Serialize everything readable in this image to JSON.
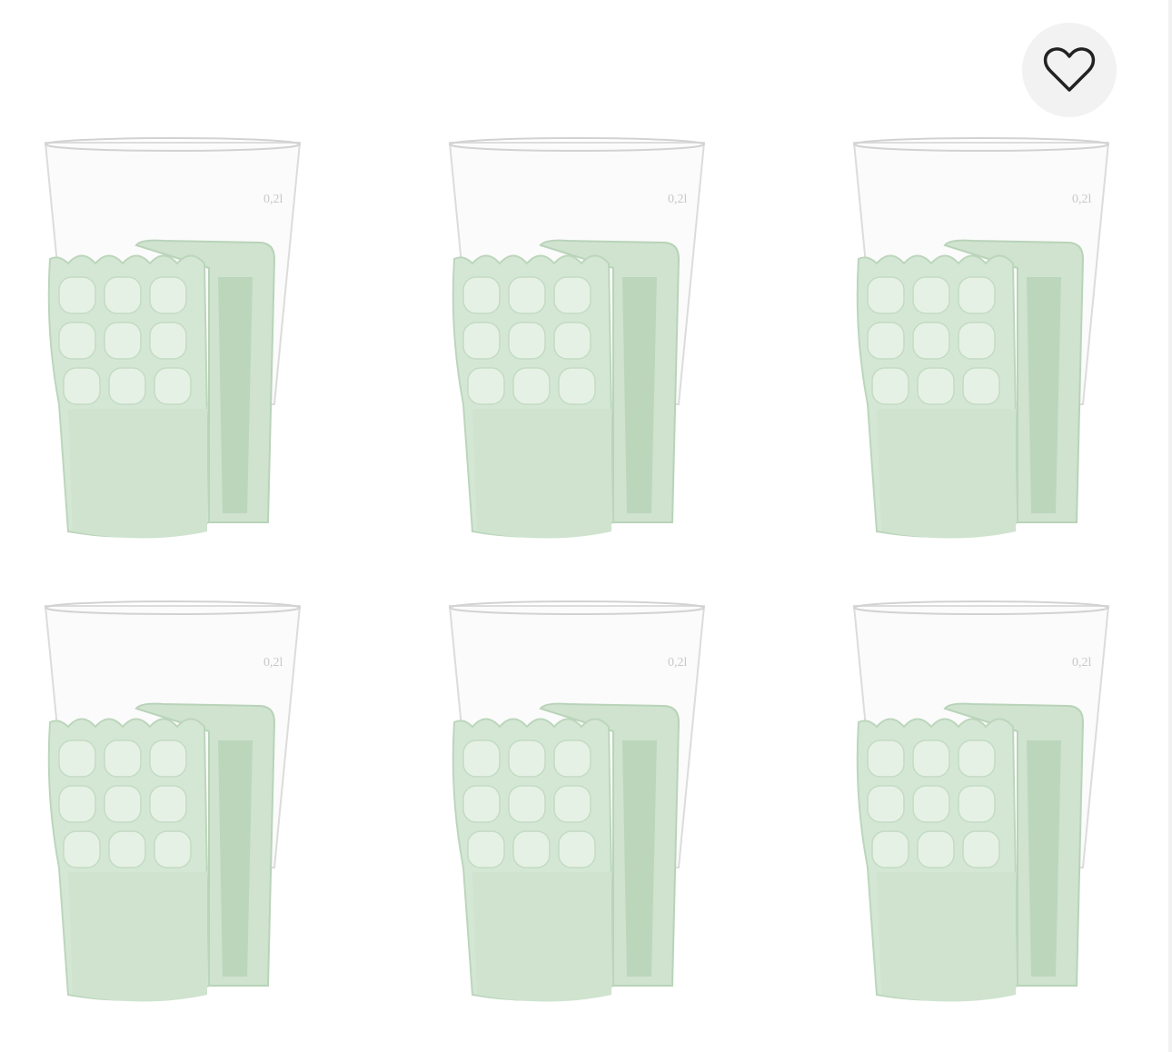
{
  "product": {
    "cups": [
      {
        "id": "cup-1",
        "capacity_mark": "0,2l"
      },
      {
        "id": "cup-2",
        "capacity_mark": "0,2l"
      },
      {
        "id": "cup-3",
        "capacity_mark": "0,2l"
      },
      {
        "id": "cup-4",
        "capacity_mark": "0,2l"
      },
      {
        "id": "cup-5",
        "capacity_mark": "0,2l"
      },
      {
        "id": "cup-6",
        "capacity_mark": "0,2l"
      }
    ],
    "holder_color": "#cfe3cf",
    "holder_shade": "#b9d3b9",
    "cup_outline": "#d8d8d8"
  },
  "favorite": {
    "icon": "heart-outline-icon",
    "background": "#f2f2f2"
  }
}
